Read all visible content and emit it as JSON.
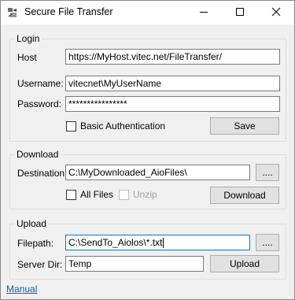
{
  "window": {
    "title": "Secure File Transfer",
    "icon": "file-transfer-app-icon",
    "controls": [
      "minimize-icon",
      "maximize-icon",
      "close-icon"
    ]
  },
  "login": {
    "legend": "Login",
    "host_label": "Host",
    "host_value": "https://MyHost.vitec.net/FileTransfer/",
    "username_label": "Username:",
    "username_value": "vitecnet\\MyUserName",
    "password_label": "Password:",
    "password_value": "****************",
    "basic_auth_label": "Basic Authentication",
    "basic_auth_checked": false,
    "save_label": "Save"
  },
  "download": {
    "legend": "Download",
    "destination_label": "Destination:",
    "destination_value": "C:\\MyDownloaded_AioFiles\\",
    "browse_label": "....",
    "all_files_label": "All Files",
    "all_files_checked": false,
    "unzip_label": "Unzip",
    "unzip_checked": false,
    "unzip_enabled": false,
    "download_label": "Download"
  },
  "upload": {
    "legend": "Upload",
    "filepath_label": "Filepath:",
    "filepath_value": "C:\\SendTo_Aiolos\\*.txt",
    "browse_label": "....",
    "server_dir_label": "Server Dir:",
    "server_dir_value": "Temp",
    "upload_label": "Upload"
  },
  "footer": {
    "manual_link": "Manual"
  },
  "colors": {
    "window_bg": "#f0f0f0",
    "titlebar_bg": "#ffffff",
    "focus_border": "#0078d7",
    "link": "#0066cc"
  }
}
